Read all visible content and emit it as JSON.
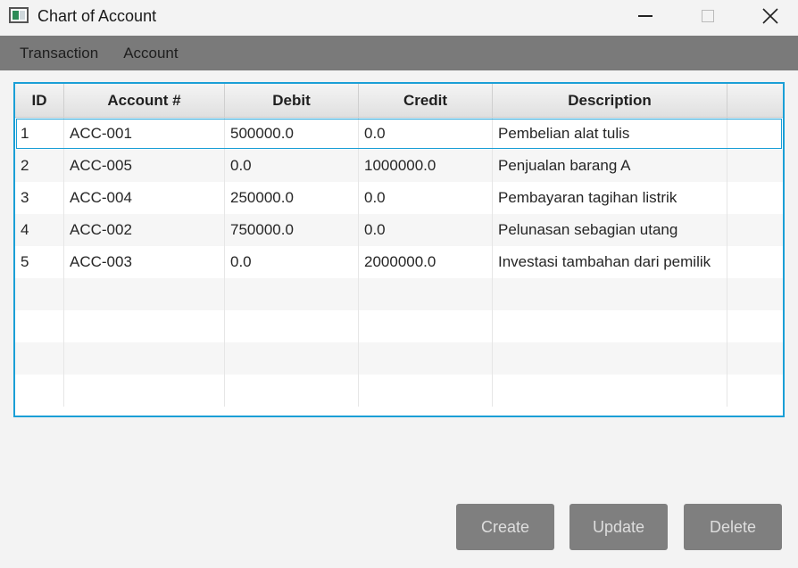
{
  "window": {
    "title": "Chart of Account"
  },
  "menu": {
    "items": [
      "Transaction",
      "Account"
    ]
  },
  "table": {
    "columns": [
      "ID",
      "Account #",
      "Debit",
      "Credit",
      "Description",
      ""
    ],
    "rows": [
      {
        "id": "1",
        "account": "ACC-001",
        "debit": "500000.0",
        "credit": "0.0",
        "description": "Pembelian alat tulis"
      },
      {
        "id": "2",
        "account": "ACC-005",
        "debit": "0.0",
        "credit": "1000000.0",
        "description": "Penjualan barang A"
      },
      {
        "id": "3",
        "account": "ACC-004",
        "debit": "250000.0",
        "credit": "0.0",
        "description": "Pembayaran tagihan listrik"
      },
      {
        "id": "4",
        "account": "ACC-002",
        "debit": "750000.0",
        "credit": "0.0",
        "description": "Pelunasan sebagian utang"
      },
      {
        "id": "5",
        "account": "ACC-003",
        "debit": "0.0",
        "credit": "2000000.0",
        "description": "Investasi tambahan dari pemilik"
      }
    ],
    "selected_row": 0
  },
  "actions": {
    "create_label": "Create",
    "update_label": "Update",
    "delete_label": "Delete"
  },
  "colors": {
    "accent": "#1a9fd6",
    "menubar": "#7a7a7a",
    "button": "#7f7f7f"
  },
  "icons": {
    "app": "app-window-icon",
    "minimize": "minimize-icon",
    "maximize": "maximize-icon",
    "close": "close-icon"
  }
}
